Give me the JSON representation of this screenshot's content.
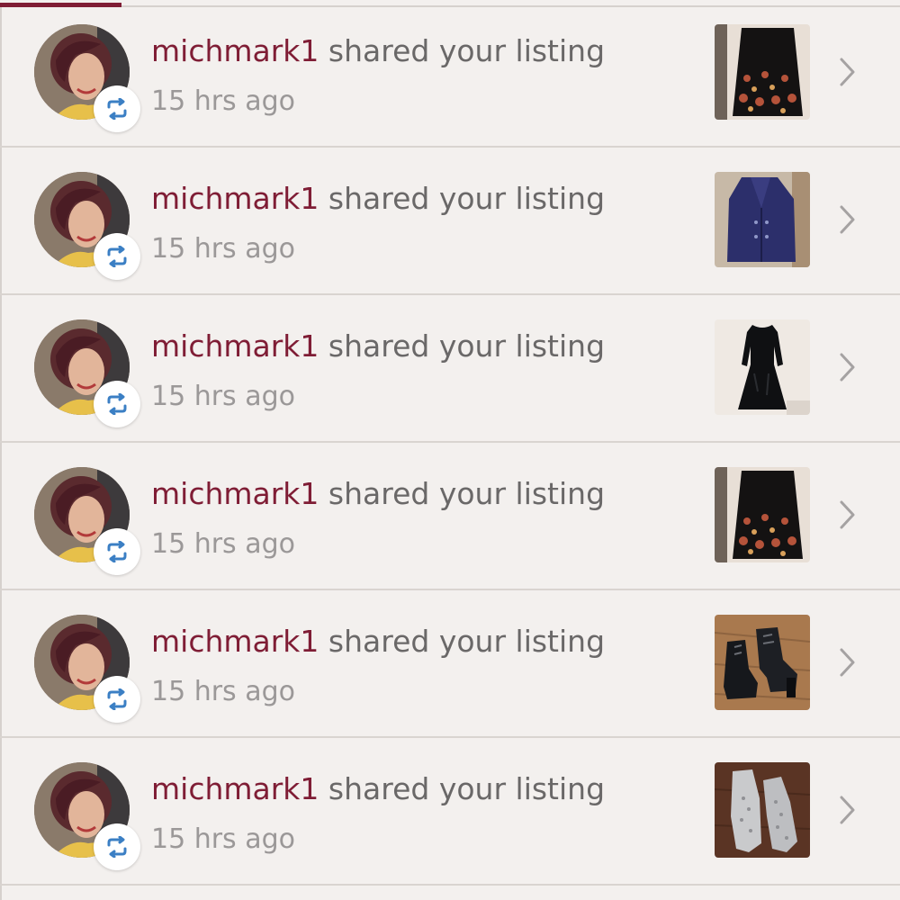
{
  "notifications": [
    {
      "username": "michmark1",
      "action": "shared your listing",
      "time": "15 hrs ago",
      "badge_icon": "share-repost-icon",
      "thumbnail": "embroidered-skirt",
      "chevron_icon": "chevron-right-icon"
    },
    {
      "username": "michmark1",
      "action": "shared your listing",
      "time": "15 hrs ago",
      "badge_icon": "share-repost-icon",
      "thumbnail": "navy-jacket",
      "chevron_icon": "chevron-right-icon"
    },
    {
      "username": "michmark1",
      "action": "shared your listing",
      "time": "15 hrs ago",
      "badge_icon": "share-repost-icon",
      "thumbnail": "black-velvet-dress",
      "chevron_icon": "chevron-right-icon"
    },
    {
      "username": "michmark1",
      "action": "shared your listing",
      "time": "15 hrs ago",
      "badge_icon": "share-repost-icon",
      "thumbnail": "embroidered-skirt",
      "chevron_icon": "chevron-right-icon"
    },
    {
      "username": "michmark1",
      "action": "shared your listing",
      "time": "15 hrs ago",
      "badge_icon": "share-repost-icon",
      "thumbnail": "black-ankle-boots",
      "chevron_icon": "chevron-right-icon"
    },
    {
      "username": "michmark1",
      "action": "shared your listing",
      "time": "15 hrs ago",
      "badge_icon": "share-repost-icon",
      "thumbnail": "gray-sneakers",
      "chevron_icon": "chevron-right-icon"
    }
  ],
  "colors": {
    "brand": "#7f1d35",
    "text": "#6a6868",
    "muted": "#9b9898",
    "background": "#f3f0ee",
    "divider": "#d9d4d0",
    "share_icon": "#3b7fc4"
  }
}
